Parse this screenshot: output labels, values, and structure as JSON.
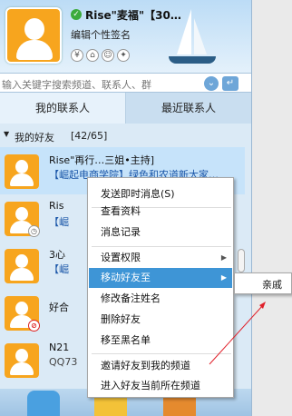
{
  "profile": {
    "nickname": "Rise\"麦福\"【30…",
    "signature": "编辑个性签名",
    "status_icon": "online-check-icon",
    "header_icons": [
      "yuan-icon",
      "home-icon",
      "user-icon",
      "gift-icon"
    ]
  },
  "search": {
    "placeholder": "输入关键字搜索频道、联系人、群"
  },
  "tabs": [
    {
      "label": "我的联系人",
      "active": true
    },
    {
      "label": "最近联系人",
      "active": false
    }
  ],
  "group": {
    "name": "我的好友",
    "count": "[42/65]"
  },
  "contacts": [
    {
      "name": "Rise\"再行…三姐•主持]",
      "sub": "【崛起电商学院】绿色和农道新大家…",
      "badge": ""
    },
    {
      "name": "Ris",
      "sub": "【崛",
      "badge": "clock"
    },
    {
      "name": "3心",
      "sub": "【崛",
      "badge": ""
    },
    {
      "name": "好合",
      "sub": "",
      "badge": "blocked"
    },
    {
      "name": "N21",
      "sub": "QQ73",
      "badge": ""
    }
  ],
  "context_menu": {
    "items": [
      {
        "label": "发送即时消息(S)",
        "highlight": false,
        "submenu": false
      },
      {
        "label": "查看资料",
        "highlight": false,
        "submenu": false
      },
      {
        "label": "消息记录",
        "highlight": false,
        "submenu": false
      },
      {
        "label": "设置权限",
        "highlight": false,
        "submenu": true
      },
      {
        "label": "移动好友至",
        "highlight": true,
        "submenu": true
      },
      {
        "label": "修改备注姓名",
        "highlight": false,
        "submenu": false
      },
      {
        "label": "删除好友",
        "highlight": false,
        "submenu": false
      },
      {
        "label": "移至黑名单",
        "highlight": false,
        "submenu": false
      },
      {
        "label": "邀请好友到我的频道",
        "highlight": false,
        "submenu": false
      },
      {
        "label": "进入好友当前所在频道",
        "highlight": false,
        "submenu": false
      }
    ]
  },
  "submenu": {
    "item": "亲戚"
  },
  "colors": {
    "accent": "#3e95d6",
    "avatar": "#f7a51e",
    "arrow": "#e0202a"
  }
}
